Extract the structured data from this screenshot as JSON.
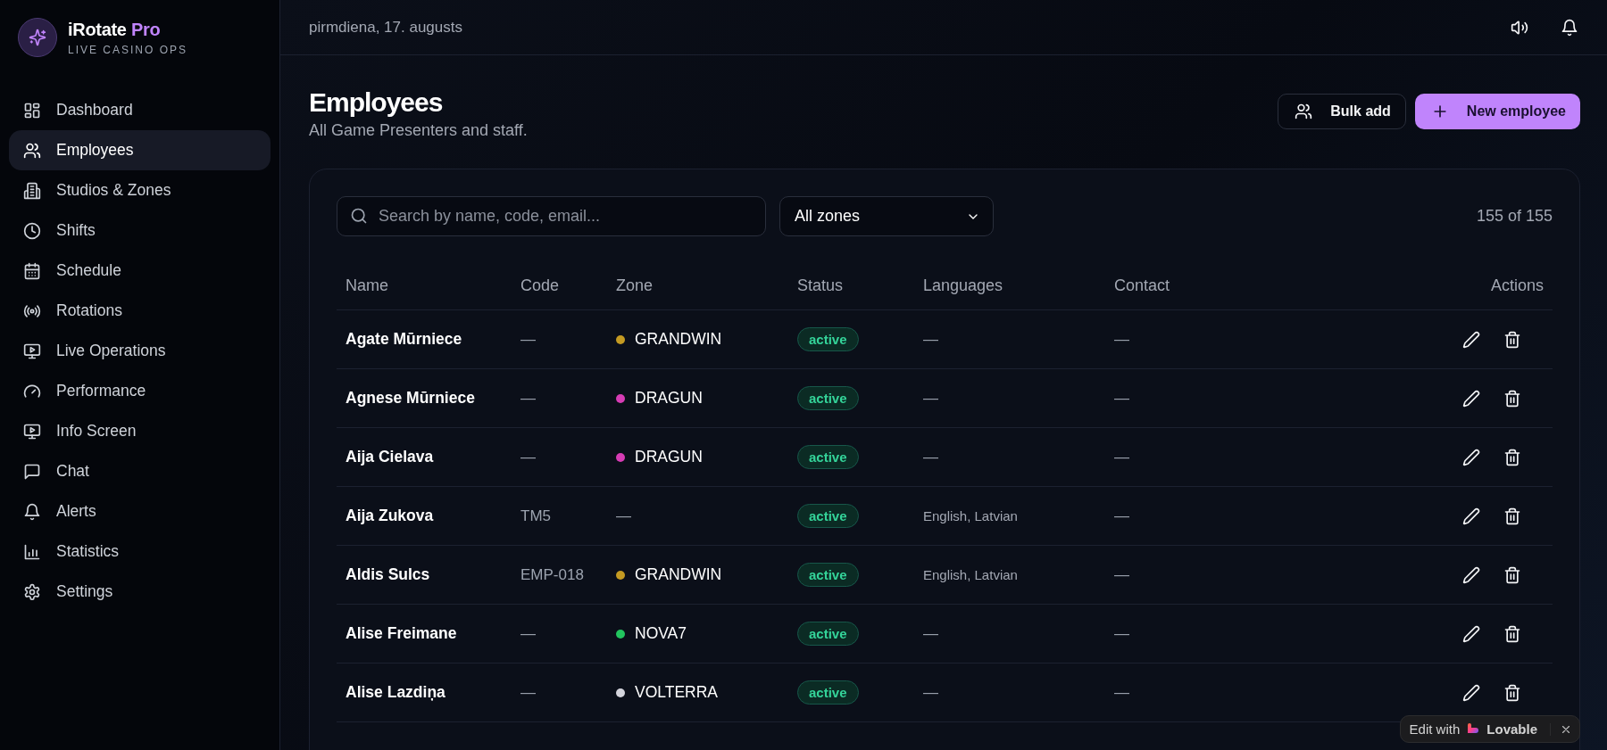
{
  "brand": {
    "name": "iRotate",
    "accent": "Pro",
    "tagline": "LIVE CASINO OPS"
  },
  "sidebar": {
    "items": [
      {
        "label": "Dashboard",
        "selected": false
      },
      {
        "label": "Employees",
        "selected": true
      },
      {
        "label": "Studios & Zones",
        "selected": false
      },
      {
        "label": "Shifts",
        "selected": false
      },
      {
        "label": "Schedule",
        "selected": false
      },
      {
        "label": "Rotations",
        "selected": false
      },
      {
        "label": "Live Operations",
        "selected": false
      },
      {
        "label": "Performance",
        "selected": false
      },
      {
        "label": "Info Screen",
        "selected": false
      },
      {
        "label": "Chat",
        "selected": false
      },
      {
        "label": "Alerts",
        "selected": false
      },
      {
        "label": "Statistics",
        "selected": false
      },
      {
        "label": "Settings",
        "selected": false
      }
    ]
  },
  "topbar": {
    "date": "pirmdiena, 17. augusts"
  },
  "page": {
    "title": "Employees",
    "subtitle": "All Game Presenters and staff.",
    "buttons": [
      {
        "label": "Bulk add",
        "kind": "secondary"
      },
      {
        "label": "New employee",
        "kind": "primary"
      }
    ]
  },
  "filters": {
    "search": {
      "placeholder": "Search by name, code, email..."
    },
    "zone": {
      "value": "All zones"
    },
    "count": "155 of 155"
  },
  "table": {
    "columns": [
      "Name",
      "Code",
      "Zone",
      "Status",
      "Languages",
      "Contact",
      "Actions"
    ],
    "rows": [
      {
        "name": "Agate Mūrniece",
        "code": "—",
        "zone": "GRANDWIN",
        "color": "#c49a22",
        "status": "active",
        "languages": "—",
        "contact": "—"
      },
      {
        "name": "Agnese Mūrniece",
        "code": "—",
        "zone": "DRAGUN",
        "color": "#d63cb4",
        "status": "active",
        "languages": "—",
        "contact": "—"
      },
      {
        "name": "Aija Cielava",
        "code": "—",
        "zone": "DRAGUN",
        "color": "#d63cb4",
        "status": "active",
        "languages": "—",
        "contact": "—"
      },
      {
        "name": "Aija Zukova",
        "code": "TM5",
        "zone": "—",
        "status": "active",
        "languages": "English, Latvian",
        "contact": "—"
      },
      {
        "name": "Aldis Sulcs",
        "code": "EMP-018",
        "zone": "GRANDWIN",
        "color": "#c49a22",
        "status": "active",
        "languages": "English, Latvian",
        "contact": "—"
      },
      {
        "name": "Alise Freimane",
        "code": "—",
        "zone": "NOVA7",
        "color": "#22c55e",
        "status": "active",
        "languages": "—",
        "contact": "—"
      },
      {
        "name": "Alise Lazdiņa",
        "code": "—",
        "zone": "VOLTERRA",
        "color": "#d4d4dc",
        "status": "active",
        "languages": "—",
        "contact": "—"
      }
    ]
  },
  "badge": {
    "prefix": "Edit with",
    "brand": "Lovable"
  }
}
